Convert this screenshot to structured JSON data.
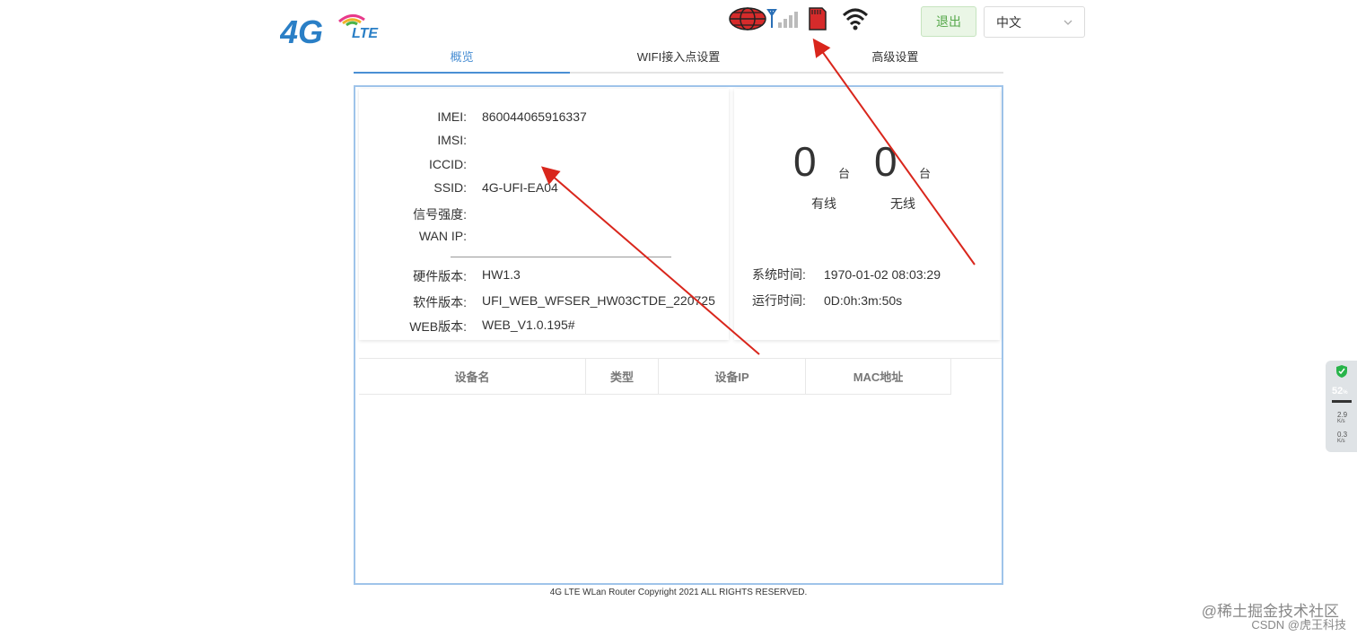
{
  "header": {
    "logo_text_4g": "4G",
    "logo_text_lte": "LTE",
    "logout_label": "退出",
    "language_selected": "中文",
    "status_icons": [
      "globe-icon",
      "signal-antenna-icon",
      "sim-card-icon",
      "wifi-icon"
    ]
  },
  "tabs": [
    {
      "label": "概览",
      "active": true
    },
    {
      "label": "WIFI接入点设置",
      "active": false
    },
    {
      "label": "高级设置",
      "active": false
    }
  ],
  "device_info": {
    "imei_label": "IMEI:",
    "imei_value": "860044065916337",
    "imsi_label": "IMSI:",
    "imsi_value": "",
    "iccid_label": "ICCID:",
    "iccid_value": "",
    "ssid_label": "SSID:",
    "ssid_value": "4G-UFI-EA04",
    "signal_label": "信号强度:",
    "signal_value": "",
    "wanip_label": "WAN IP:",
    "wanip_value": "",
    "hw_label": "硬件版本:",
    "hw_value": "HW1.3",
    "sw_label": "软件版本:",
    "sw_value": "UFI_WEB_WFSER_HW03CTDE_220725",
    "web_label": "WEB版本:",
    "web_value": "WEB_V1.0.195#"
  },
  "stats": {
    "wired_count": "0",
    "wireless_count": "0",
    "unit": "台",
    "wired_label": "有线",
    "wireless_label": "无线",
    "system_time_label": "系统时间:",
    "system_time_value": "1970-01-02 08:03:29",
    "uptime_label": "运行时间:",
    "uptime_value": "0D:0h:3m:50s"
  },
  "device_table": {
    "columns": [
      "设备名",
      "类型",
      "设备IP",
      "MAC地址"
    ],
    "rows": []
  },
  "footer": "4G LTE WLan Router Copyright 2021 ALL RIGHTS RESERVED.",
  "side_widget": {
    "percent": "52",
    "percent_unit": "%",
    "up_speed": "2.9",
    "down_speed": "0.3",
    "speed_unit": "K/s"
  },
  "watermark": {
    "line1": "@稀土掘金技术社区",
    "line2": "CSDN @虎王科技"
  },
  "colors": {
    "accent": "#4a8fd4",
    "panel_border": "#9fc4ea",
    "logout_green": "#56a84a",
    "arrow_red": "#d9261c"
  }
}
